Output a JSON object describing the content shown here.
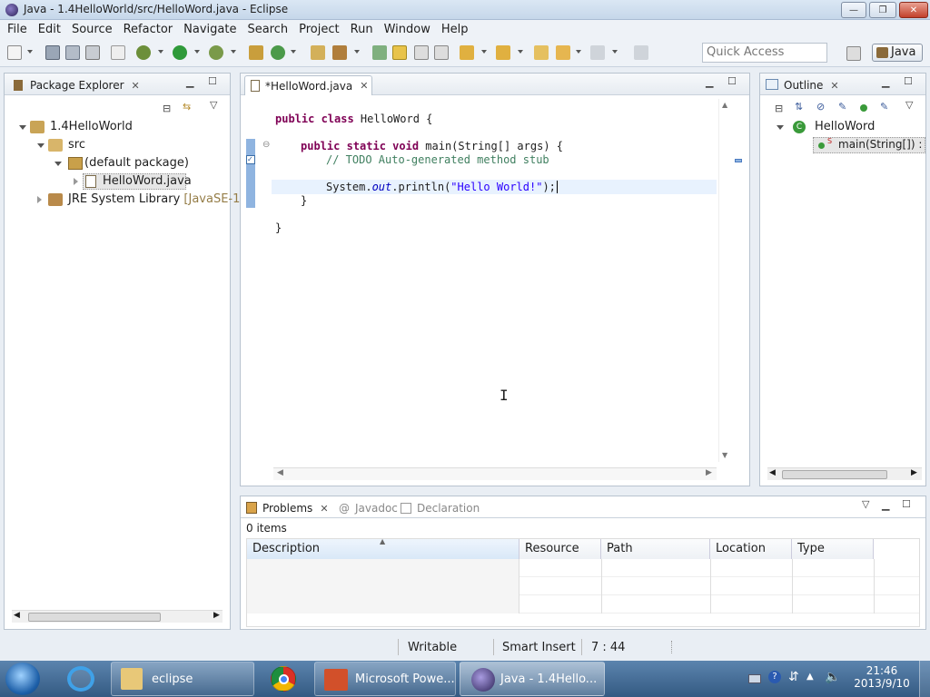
{
  "window": {
    "title": "Java - 1.4HelloWorld/src/HelloWord.java - Eclipse"
  },
  "menu": [
    "File",
    "Edit",
    "Source",
    "Refactor",
    "Navigate",
    "Search",
    "Project",
    "Run",
    "Window",
    "Help"
  ],
  "toolbar": {
    "quick_access_placeholder": "Quick Access",
    "perspective": "Java"
  },
  "package_explorer": {
    "tab": "Package Explorer",
    "project": "1.4HelloWorld",
    "src": "src",
    "package": "(default package)",
    "file": "HelloWord.java",
    "jre_label": "JRE System Library",
    "jre_version": "[JavaSE-1."
  },
  "editor": {
    "tab": "*HelloWord.java",
    "code": {
      "l1_kw": "public class",
      "l1_rest": " HelloWord {",
      "l2_kw": "public static void",
      "l2_rest": " main(String[] args) {",
      "l3": "// TODO Auto-generated method stub",
      "l4_a": "System.",
      "l4_field": "out",
      "l4_b": ".println(",
      "l4_str": "\"Hello World!\"",
      "l4_c": ");",
      "l5": "}",
      "l6": "}"
    }
  },
  "outline": {
    "tab": "Outline",
    "class": "HelloWord",
    "method": "main(String[]) :"
  },
  "problems": {
    "tabs": [
      "Problems",
      "Javadoc",
      "Declaration"
    ],
    "count": "0 items",
    "columns": [
      "Description",
      "Resource",
      "Path",
      "Location",
      "Type"
    ]
  },
  "status": {
    "writable": "Writable",
    "insert": "Smart Insert",
    "position": "7 : 44"
  },
  "taskbar": {
    "items": [
      "eclipse",
      "Microsoft Powe...",
      "Java - 1.4Hello..."
    ],
    "time": "21:46",
    "date": "2013/9/10"
  },
  "colors": {
    "keyword": "#7f0055",
    "comment": "#3f7f5f",
    "string": "#2a00ff",
    "field": "#0000c0"
  }
}
